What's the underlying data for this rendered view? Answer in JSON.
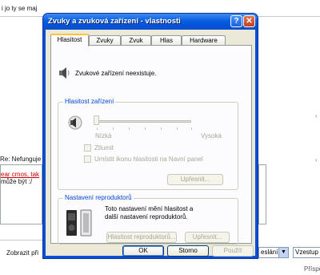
{
  "background": {
    "top_text": "i jo ty se maj",
    "reply_title": "Re: Nefunguje",
    "reply_line1": "ear cmos, tak",
    "reply_line2": "může být :/",
    "show_label": "Zobrazit při",
    "select1_value": "eslání",
    "select2_value": "Vzestup",
    "bottom_right": "Příspě"
  },
  "window": {
    "title": "Zvuky a zvuková zařízení - vlastnosti",
    "help_glyph": "?",
    "close_glyph": "✕"
  },
  "tabs": [
    {
      "label": "Hlasitost"
    },
    {
      "label": "Zvuky"
    },
    {
      "label": "Zvuk"
    },
    {
      "label": "Hlas"
    },
    {
      "label": "Hardware"
    }
  ],
  "panel": {
    "status": "Zvukové zařízení neexistuje.",
    "device_volume": {
      "title": "Hlasitost zařízení",
      "low": "Nízká",
      "high": "Vysoká",
      "level": 0,
      "mute": "Ztlumit",
      "taskbar_icon": "Umístit ikonu hlasitosti na Navní panel",
      "advanced": "Upřesnit..."
    },
    "speakers": {
      "title": "Nastavení reproduktorů",
      "description": "Toto nastavení mění hlasitost a další nastavení reproduktorů.",
      "volume_button": "Hlasitost reproduktorů...",
      "advanced": "Upřesnit..."
    }
  },
  "buttons": {
    "ok": "OK",
    "cancel": "Storno",
    "apply": "Použít"
  },
  "icons": {
    "speaker": "speaker-icon",
    "speaker_knob": "speaker-volume-icon",
    "speakers_pair": "desktop-speakers-icon"
  },
  "colors": {
    "titlebar": "#0a5fe0",
    "group_label": "#0046d5",
    "tab_highlight": "#ffc83c",
    "dialog_bg": "#ece9d8"
  }
}
